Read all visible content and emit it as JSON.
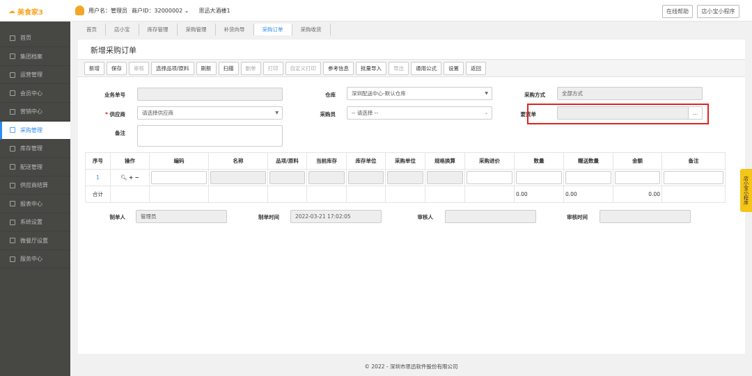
{
  "header": {
    "logo": "美食家3",
    "user_label": "用户名：管理员",
    "merchant_label": "商户ID：32000002",
    "store": "思迅大酒楼1",
    "help": "在线帮助",
    "mini": "店小宝小程序"
  },
  "sidebar": {
    "items": [
      {
        "label": "首页",
        "icon": "home-icon"
      },
      {
        "label": "集团档案",
        "icon": "file-icon"
      },
      {
        "label": "运营管理",
        "icon": "bar-chart-icon"
      },
      {
        "label": "会员中心",
        "icon": "id-card-icon"
      },
      {
        "label": "营销中心",
        "icon": "edit-icon"
      },
      {
        "label": "采购管理",
        "icon": "book-icon",
        "active": true
      },
      {
        "label": "库存管理",
        "icon": "phone-icon"
      },
      {
        "label": "配送管理",
        "icon": "truck-icon"
      },
      {
        "label": "供应商结算",
        "icon": "bitcoin-icon"
      },
      {
        "label": "报表中心",
        "icon": "report-icon"
      },
      {
        "label": "系统设置",
        "icon": "gears-icon"
      },
      {
        "label": "微餐厅设置",
        "icon": "utensils-icon"
      },
      {
        "label": "服务中心",
        "icon": "service-icon"
      }
    ]
  },
  "tabs": [
    "首页",
    "店小宝",
    "库存管理",
    "采购管理",
    "补货向导",
    "采购订单",
    "采购收货"
  ],
  "page": {
    "title": "新增采购订单"
  },
  "toolbar": [
    {
      "label": "新增"
    },
    {
      "label": "保存"
    },
    {
      "label": "审核",
      "disabled": true
    },
    {
      "label": "选择品项/原料"
    },
    {
      "label": "刷新"
    },
    {
      "label": "扫描"
    },
    {
      "label": "删单",
      "disabled": true
    },
    {
      "label": "打印",
      "disabled": true
    },
    {
      "label": "自定义打印",
      "disabled": true
    },
    {
      "label": "参考信息"
    },
    {
      "label": "批量导入"
    },
    {
      "label": "导出",
      "disabled": true
    },
    {
      "label": "通用公式"
    },
    {
      "label": "设置"
    },
    {
      "label": "返回"
    }
  ],
  "form": {
    "order_no_label": "业务单号",
    "order_no": "",
    "warehouse_label": "仓库",
    "warehouse": "深圳配送中心-默认仓库",
    "method_label": "采购方式",
    "method": "全部方式",
    "supplier_label": "供应商",
    "supplier": "请选择供应商",
    "buyer_label": "采购员",
    "buyer": "-- 请选择 --",
    "request_label": "要货单",
    "request_btn": "...",
    "remark_label": "备注"
  },
  "table": {
    "headers": [
      "序号",
      "操作",
      "编码",
      "名称",
      "品项/原料",
      "当前库存",
      "库存单位",
      "采购单位",
      "规格换算",
      "采购进价",
      "数量",
      "赠送数量",
      "金额",
      "备注"
    ],
    "row_no": "1",
    "total_label": "合计",
    "total_qty": "0.00",
    "total_gift": "0.00",
    "total_amount": "0.00"
  },
  "meta": {
    "maker_label": "制单人",
    "maker": "管理员",
    "make_time_label": "制单时间",
    "make_time": "2022-03-21 17:02:05",
    "auditor_label": "审核人",
    "audit_time_label": "审核时间"
  },
  "footer": "© 2022 - 深圳市思迅软件股份有限公司",
  "float_tab": "店小宝小程序"
}
